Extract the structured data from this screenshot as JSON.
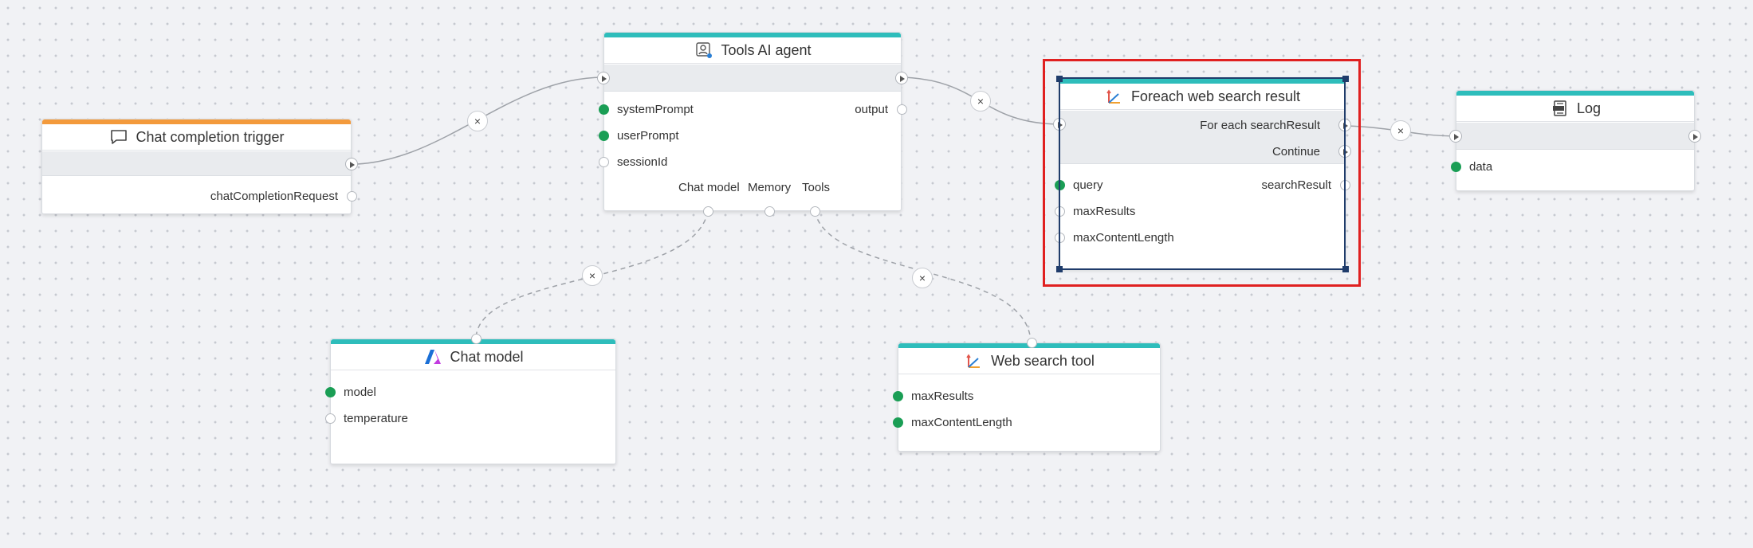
{
  "nodes": {
    "chat_trigger": {
      "title": "Chat completion trigger",
      "outputs": [
        "chatCompletionRequest"
      ],
      "accent": "#f39a3c"
    },
    "tools_agent": {
      "title": "Tools AI agent",
      "inputs": [
        "systemPrompt",
        "userPrompt",
        "sessionId"
      ],
      "outputs": [
        "output"
      ],
      "sub_connectors": [
        "Chat model",
        "Memory",
        "Tools"
      ],
      "accent": "#2ebdbb"
    },
    "foreach": {
      "title": "Foreach web search result",
      "flow_outputs": [
        "For each searchResult",
        "Continue"
      ],
      "inputs": [
        "query",
        "maxResults",
        "maxContentLength"
      ],
      "outputs": [
        "searchResult"
      ],
      "accent": "#2ebdbb"
    },
    "log": {
      "title": "Log",
      "inputs": [
        "data"
      ],
      "accent": "#2ebdbb"
    },
    "chat_model": {
      "title": "Chat model",
      "inputs": [
        "model",
        "temperature"
      ],
      "accent": "#2ebdbb"
    },
    "web_search": {
      "title": "Web search tool",
      "inputs": [
        "maxResults",
        "maxContentLength"
      ],
      "accent": "#2ebdbb"
    }
  },
  "remove_glyph": "×",
  "colors": {
    "connected_port": "#1a9e55",
    "selection": "#1f3c6b",
    "highlight": "#e02020",
    "canvas": "#f1f2f5"
  },
  "icons": {
    "chat_trigger": "chat-bubble-icon",
    "tools_agent": "agent-icon",
    "foreach": "loop-icon",
    "log": "log-icon",
    "chat_model": "azure-openai-icon",
    "web_search": "search-tool-icon"
  }
}
